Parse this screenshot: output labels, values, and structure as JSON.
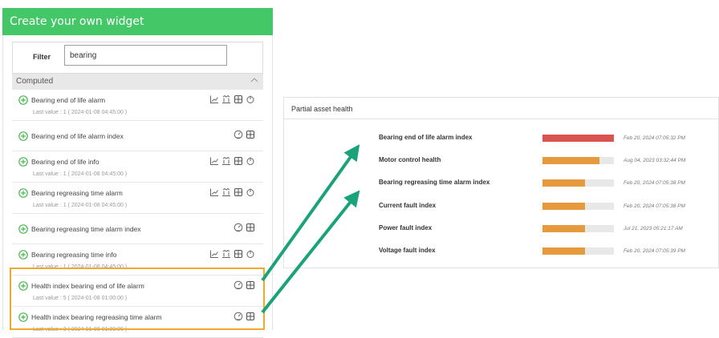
{
  "panel": {
    "title": "Create your own widget",
    "filter_label": "Filter",
    "filter_value": "bearing",
    "section_label": "Computed"
  },
  "items": [
    {
      "name": "Bearing end of life alarm",
      "last_value": "Last value : 1 ( 2024-01-08 04:45:00 )",
      "icons": [
        "line-chart-icon",
        "trend-icon",
        "tile-icon",
        "power-icon"
      ]
    },
    {
      "name": "Bearing end of life alarm index",
      "last_value": "",
      "icons": [
        "gauge-icon",
        "tile-icon"
      ]
    },
    {
      "name": "Bearing end of life info",
      "last_value": "Last value : 1 ( 2024-01-08 04:45:00 )",
      "icons": [
        "line-chart-icon",
        "trend-icon",
        "tile-icon",
        "power-icon"
      ]
    },
    {
      "name": "Bearing regreasing time alarm",
      "last_value": "Last value : 1 ( 2024-01-08 04:45:00 )",
      "icons": [
        "line-chart-icon",
        "trend-icon",
        "tile-icon",
        "power-icon"
      ]
    },
    {
      "name": "Bearing regreasing time alarm index",
      "last_value": "",
      "icons": [
        "gauge-icon",
        "tile-icon"
      ]
    },
    {
      "name": "Bearing regreasing time info",
      "last_value": "Last value : 1 ( 2024-01-08 04:45:00 )",
      "icons": [
        "line-chart-icon",
        "trend-icon",
        "tile-icon",
        "power-icon"
      ]
    },
    {
      "name": "Health index bearing end of life alarm",
      "last_value": "Last value : 5 ( 2024-01-08 01:00:00 )",
      "icons": [
        "gauge-icon",
        "tile-icon"
      ]
    },
    {
      "name": "Health index bearing regreasing time alarm",
      "last_value": "Last value : 3 ( 2024-01-08 01:00:00 )",
      "icons": [
        "gauge-icon",
        "tile-icon"
      ]
    }
  ],
  "health": {
    "title": "Partial asset health",
    "rows": [
      {
        "label": "Bearing end of life alarm index",
        "level": 1.0,
        "color": "#d9534f",
        "date": "Feb 20, 2024 07:05:32 PM"
      },
      {
        "label": "Motor control health",
        "level": 0.8,
        "color": "#e69a3d",
        "date": "Aug 04, 2023 03:32:44 PM"
      },
      {
        "label": "Bearing regreasing time alarm index",
        "level": 0.6,
        "color": "#e69a3d",
        "date": "Feb 20, 2024 07:05:38 PM"
      },
      {
        "label": "Current fault index",
        "level": 0.6,
        "color": "#e69a3d",
        "date": "Feb 20, 2024 07:05:38 PM"
      },
      {
        "label": "Power fault index",
        "level": 0.6,
        "color": "#e69a3d",
        "date": "Jul 21, 2023 05:21:17 AM"
      },
      {
        "label": "Voltage fault index",
        "level": 0.6,
        "color": "#e69a3d",
        "date": "Feb 20, 2024 07:05:39 PM"
      }
    ]
  },
  "colors": {
    "header_green": "#44c767",
    "highlight_orange": "#f0a92a",
    "arrow_teal": "#1aa37a"
  }
}
